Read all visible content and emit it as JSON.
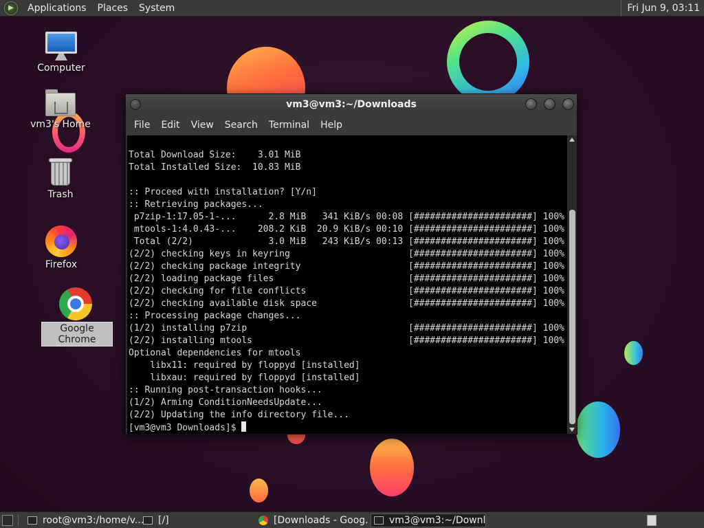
{
  "top_panel": {
    "menus": [
      "Applications",
      "Places",
      "System"
    ],
    "clock": "Fri Jun  9, 03:11"
  },
  "desktop": {
    "icons": [
      {
        "label": "Computer"
      },
      {
        "label": "vm3's Home"
      },
      {
        "label": "Trash"
      },
      {
        "label": "Firefox"
      },
      {
        "label": "Google Chrome"
      }
    ]
  },
  "window": {
    "title": "vm3@vm3:~/Downloads",
    "menus": [
      "File",
      "Edit",
      "View",
      "Search",
      "Terminal",
      "Help"
    ],
    "terminal_lines": [
      "Total Download Size:    3.01 MiB",
      "Total Installed Size:  10.83 MiB",
      "",
      ":: Proceed with installation? [Y/n]",
      ":: Retrieving packages...",
      " p7zip-1:17.05-1-...      2.8 MiB   341 KiB/s 00:08 [######################] 100%",
      " mtools-1:4.0.43-...    208.2 KiB  20.9 KiB/s 00:10 [######################] 100%",
      " Total (2/2)              3.0 MiB   243 KiB/s 00:13 [######################] 100%",
      "(2/2) checking keys in keyring                      [######################] 100%",
      "(2/2) checking package integrity                    [######################] 100%",
      "(2/2) loading package files                         [######################] 100%",
      "(2/2) checking for file conflicts                   [######################] 100%",
      "(2/2) checking available disk space                 [######################] 100%",
      ":: Processing package changes...",
      "(1/2) installing p7zip                              [######################] 100%",
      "(2/2) installing mtools                             [######################] 100%",
      "Optional dependencies for mtools",
      "    libx11: required by floppyd [installed]",
      "    libxau: required by floppyd [installed]",
      ":: Running post-transaction hooks...",
      "(1/2) Arming ConditionNeedsUpdate...",
      "(2/2) Updating the info directory file..."
    ],
    "prompt": "[vm3@vm3 Downloads]$ "
  },
  "taskbar": {
    "tasks": [
      {
        "label": "root@vm3:/home/v...",
        "icon": "terminal-icon",
        "active": false
      },
      {
        "label": "[/]",
        "icon": "terminal-icon",
        "active": false
      },
      {
        "label": "[Downloads - Goog...",
        "icon": "chrome-icon",
        "active": false
      },
      {
        "label": "vm3@vm3:~/Downl...",
        "icon": "terminal-icon",
        "active": true
      }
    ]
  }
}
